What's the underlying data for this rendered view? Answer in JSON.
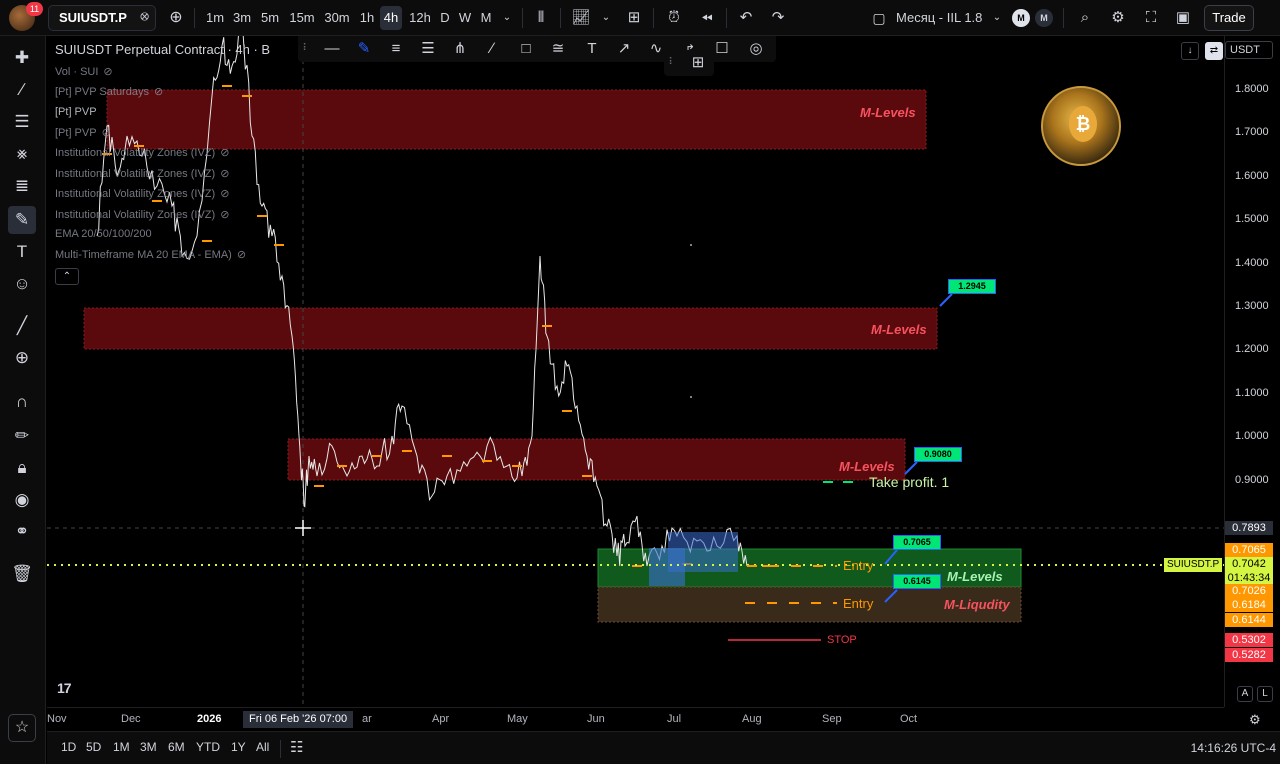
{
  "topbar": {
    "notification_count": "11",
    "symbol": "SUIUSDT.P",
    "timeframes": [
      "1m",
      "3m",
      "5m",
      "15m",
      "30m",
      "1h",
      "4h",
      "12h",
      "D",
      "W",
      "M"
    ],
    "active_timeframe": "4h",
    "layout_name": "Месяц - IIL 1.8",
    "m_circle_1": "M",
    "m_circle_2": "M",
    "trade_button": "Trade"
  },
  "chart": {
    "title": "SUIUSDT Perpetual Contract · 4h · B",
    "indicators": [
      "Vol · SUI",
      "[Pt] PVP Saturdays",
      "[Pt] PVP",
      "[Pt] PVP",
      "Institutional Volatility Zones (IVZ)",
      "Institutional Volatility Zones (IVZ)",
      "Institutional Volatility Zones (IVZ)",
      "Institutional Volatility Zones (IVZ)",
      "EMA 20/50/100/200",
      "Multi-Timeframe MA 20 EMA - EMA)"
    ],
    "zones": {
      "m_levels": "M-Levels",
      "m_liquidity": "M-Liqudity"
    },
    "tags": {
      "t1": "1.2945",
      "t2": "0.9080",
      "t3": "0.7065",
      "t4": "0.6145"
    },
    "take_profit": "Take profit. 1",
    "entry": "Entry",
    "stop": "STOP",
    "symbol_tag": "SUIUSDT.P",
    "colors": {
      "red_zone": "#5a0a0c",
      "green_zone": "#0f5a1c",
      "liquidity_zone": "#3a2a1a",
      "current_price_line": "#d4f542",
      "entry_dashes": "#ff9800",
      "stop_line": "#f23645",
      "tag_green": "#00e676"
    }
  },
  "price_scale": {
    "currency": "USDT",
    "labels": [
      "1.8000",
      "1.7000",
      "1.6000",
      "1.5000",
      "1.4000",
      "1.3000",
      "1.2000",
      "1.1000",
      "1.0000",
      "0.9000"
    ],
    "crosshair_price": "0.7893",
    "tag_0": "0.7065",
    "current_price": "0.7042",
    "countdown": "01:43:34",
    "tag_1": "0.7026",
    "tag_2": "0.6184",
    "tag_3": "0.6144",
    "tag_4": "0.5302",
    "tag_5": "0.5282",
    "auto_label": "A",
    "log_label": "L"
  },
  "time_axis": {
    "labels": [
      "Nov",
      "Dec",
      "2026",
      "ar",
      "Apr",
      "May",
      "Jun",
      "Jul",
      "Aug",
      "Sep",
      "Oct"
    ],
    "crosshair_time": "Fri 06 Feb '26   07:00"
  },
  "bottombar": {
    "ranges": [
      "1D",
      "5D",
      "1M",
      "3M",
      "6M",
      "YTD",
      "1Y",
      "All"
    ],
    "clock": "14:16:26 UTC-4"
  }
}
